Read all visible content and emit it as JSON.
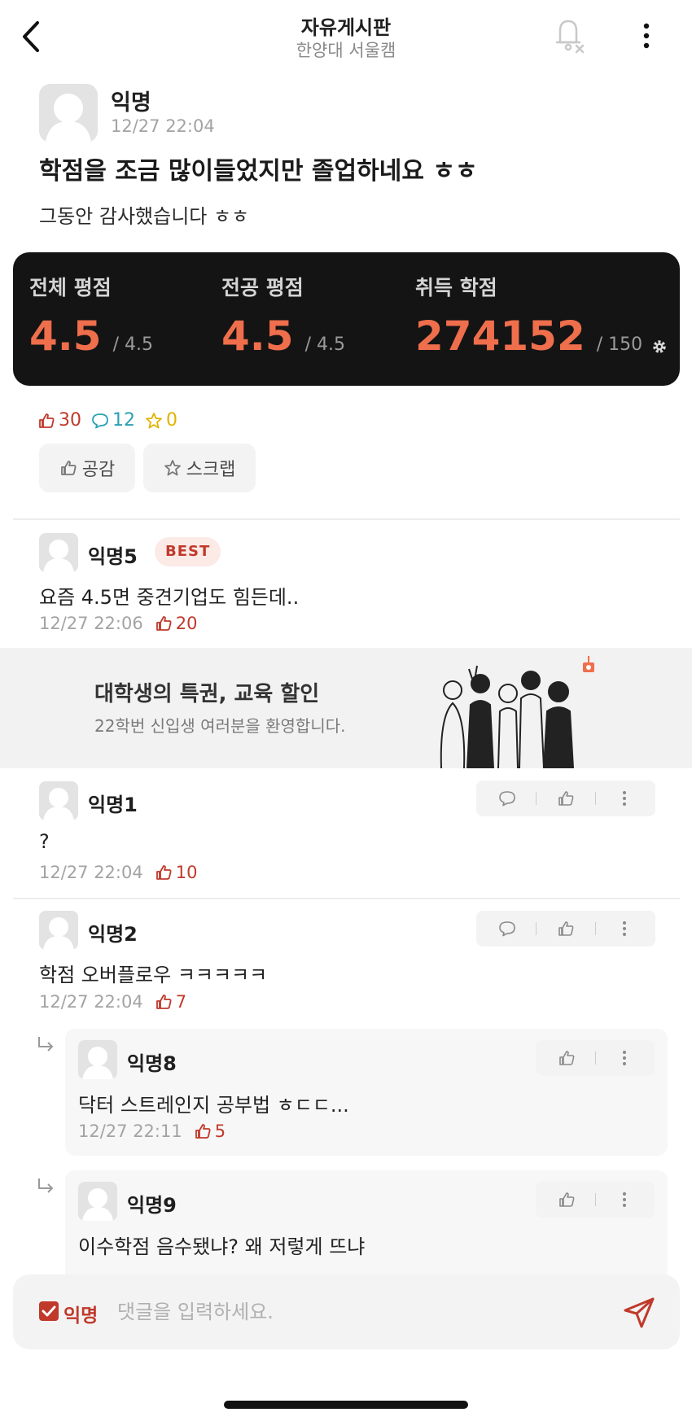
{
  "header": {
    "title": "자유게시판",
    "subtitle": "한양대 서울캠",
    "icons": {
      "back": "chevron-left-icon",
      "notify": "bell-off-icon",
      "more": "vertical-dots-icon"
    }
  },
  "post": {
    "author": "익명",
    "time": "12/27 22:04",
    "title": "학점을 조금 많이들었지만 졸업하네요 ㅎㅎ",
    "body": "그동안 감사했습니다 ㅎㅎ",
    "grades": [
      {
        "label": "전체 평점",
        "value": "4.5",
        "max": "/ 4.5"
      },
      {
        "label": "전공 평점",
        "value": "4.5",
        "max": "/ 4.5"
      },
      {
        "label": "취득 학점",
        "value": "274152",
        "max": "/ 150"
      }
    ],
    "stats": {
      "likes": "30",
      "comments": "12",
      "scraps": "0"
    },
    "actions": {
      "like": "공감",
      "scrap": "스크랩"
    }
  },
  "best_comment": {
    "author": "익명5",
    "badge": "BEST",
    "text": "요즘 4.5면 중견기업도 힘든데..",
    "time": "12/27 22:06",
    "likes": "20"
  },
  "ad": {
    "title": "대학생의 특권, 교육 할인",
    "subtitle": "22학번 신입생 여러분을 환영합니다."
  },
  "comments": [
    {
      "author": "익명1",
      "text": "?",
      "time": "12/27 22:04",
      "likes": "10"
    },
    {
      "author": "익명2",
      "text": "학점 오버플로우 ㅋㅋㅋㅋㅋ",
      "time": "12/27 22:04",
      "likes": "7"
    }
  ],
  "replies": [
    {
      "author": "익명8",
      "text": "닥터 스트레인지 공부법 ㅎㄷㄷ...",
      "time": "12/27 22:11",
      "likes": "5"
    },
    {
      "author": "익명9",
      "text": "이수학점 음수됐냐? 왜 저렇게 뜨냐"
    }
  ],
  "input": {
    "anon_label": "익명",
    "placeholder": "댓글을 입력하세요."
  },
  "colors": {
    "accent": "#c0392b",
    "grade": "#ef6e4c",
    "card": "#141414",
    "comment_icon": "#2aa0b6",
    "scrap_icon": "#e0b300"
  }
}
